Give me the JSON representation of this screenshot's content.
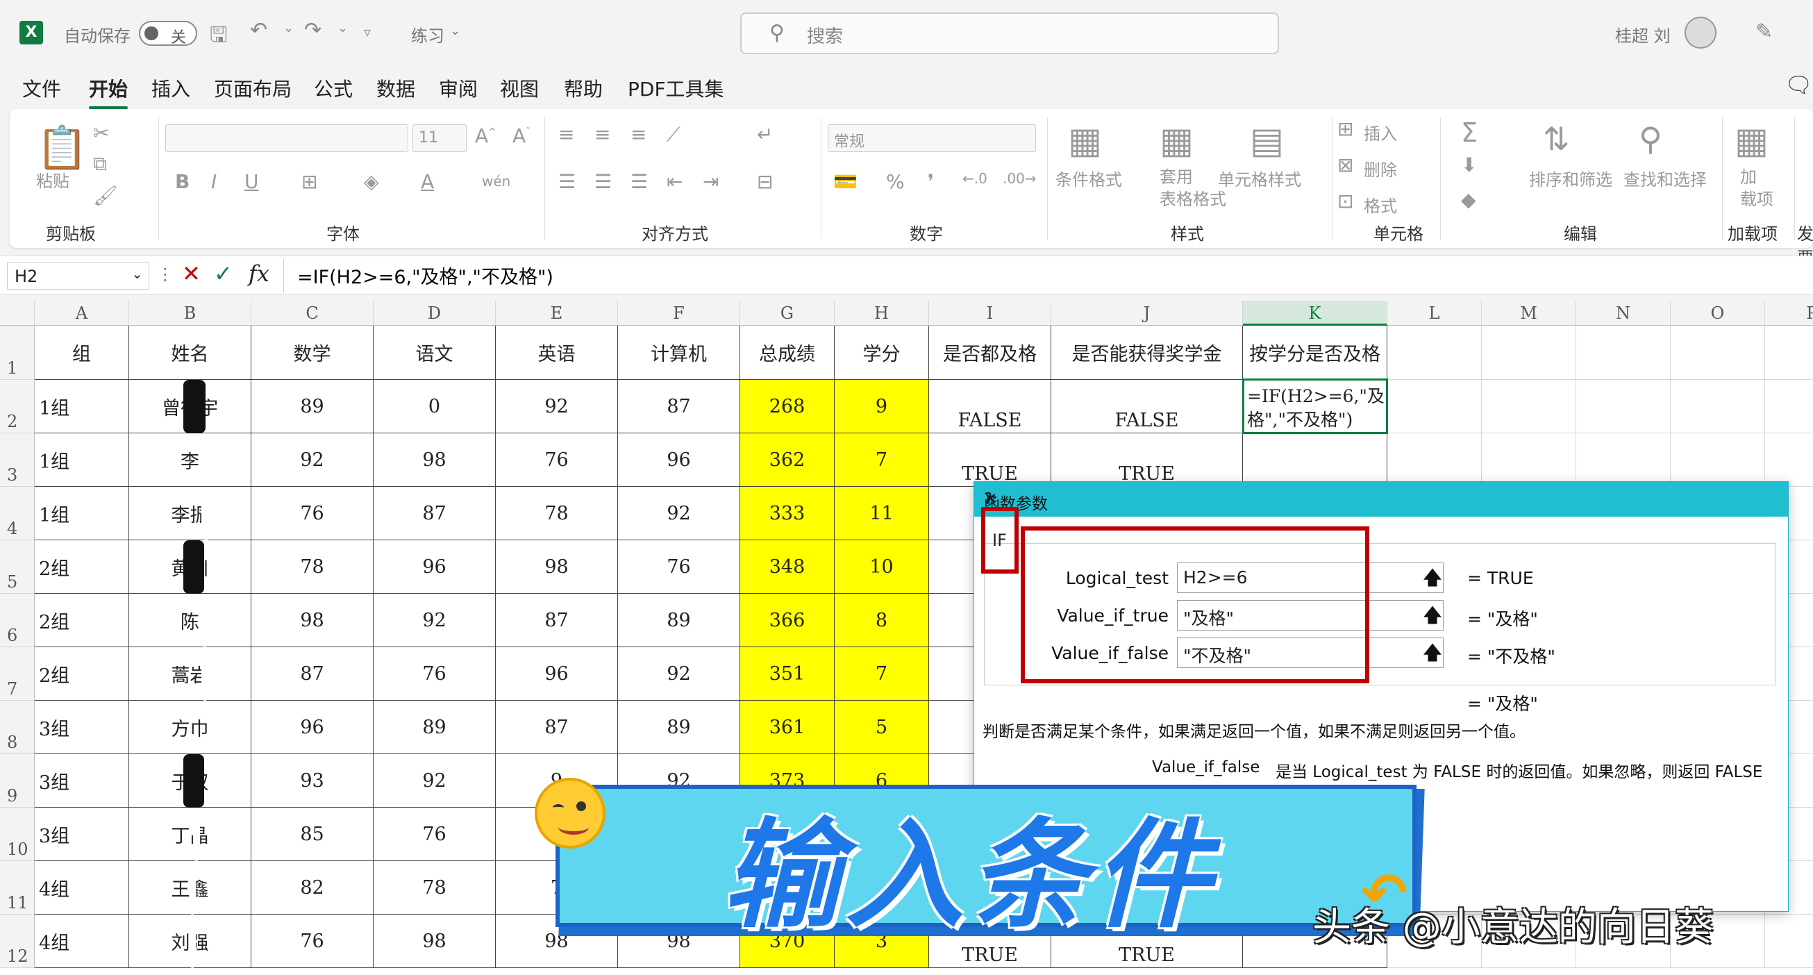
{
  "titlebar": {
    "autosave_label": "自动保存",
    "autosave_state": "关",
    "filename": "练习",
    "search_placeholder": "搜索",
    "user_name": "桂超 刘"
  },
  "menu": [
    "文件",
    "开始",
    "插入",
    "页面布局",
    "公式",
    "数据",
    "审阅",
    "视图",
    "帮助",
    "PDF工具集"
  ],
  "ribbon": {
    "groups": [
      "剪贴板",
      "字体",
      "对齐方式",
      "数字",
      "样式",
      "单元格",
      "编辑",
      "加载项",
      "发票"
    ],
    "paste": "粘贴",
    "font_size": "11",
    "number_format": "常规",
    "cond_format": "条件格式",
    "table_format": "套用\n表格格式",
    "cell_style": "单元格样式",
    "insert": "插入",
    "delete": "删除",
    "format": "格式",
    "sort_filter": "排序和筛选",
    "find_select": "查找和选择",
    "addins": "加\n载项"
  },
  "formula_bar": {
    "name_box": "H2",
    "formula": "=IF(H2>=6,\"及格\",\"不及格\")"
  },
  "columns": [
    "A",
    "B",
    "C",
    "D",
    "E",
    "F",
    "G",
    "H",
    "I",
    "J",
    "K",
    "L",
    "M",
    "N",
    "O",
    "P"
  ],
  "rows": [
    "1",
    "2",
    "3",
    "4",
    "5",
    "6",
    "7",
    "8",
    "9",
    "10",
    "11",
    "12"
  ],
  "header_row": [
    "组",
    "姓名",
    "数学",
    "语文",
    "英语",
    "计算机",
    "总成绩",
    "学分",
    "是否都及格",
    "是否能获得奖学金",
    "按学分是否及格"
  ],
  "data_rows": [
    [
      "1组",
      "曾德宇",
      "89",
      "0",
      "92",
      "87",
      "268",
      "9",
      "FALSE",
      "FALSE"
    ],
    [
      "1组",
      "李",
      "92",
      "98",
      "76",
      "96",
      "362",
      "7",
      "TRUE",
      "TRUE"
    ],
    [
      "1组",
      "李振",
      "76",
      "87",
      "78",
      "92",
      "333",
      "11",
      "",
      ""
    ],
    [
      "2组",
      "黄川",
      "78",
      "96",
      "98",
      "76",
      "348",
      "10",
      "",
      ""
    ],
    [
      "2组",
      "陈",
      "98",
      "92",
      "87",
      "89",
      "366",
      "8",
      "",
      ""
    ],
    [
      "2组",
      "蒿岩",
      "87",
      "76",
      "96",
      "92",
      "351",
      "7",
      "",
      ""
    ],
    [
      "3组",
      "方巾",
      "96",
      "89",
      "87",
      "89",
      "361",
      "5",
      "",
      ""
    ],
    [
      "3组",
      "于双",
      "93",
      "92",
      "9",
      "92",
      "373",
      "6",
      "",
      ""
    ],
    [
      "3组",
      "丁晶",
      "85",
      "76",
      "",
      "",
      "",
      "",
      "",
      ""
    ],
    [
      "4组",
      "王鑫",
      "82",
      "78",
      "7",
      "",
      "",
      "",
      "",
      ""
    ],
    [
      "4组",
      "刘强",
      "76",
      "98",
      "98",
      "98",
      "370",
      "3",
      "TRUE",
      "TRUE"
    ]
  ],
  "active_cell_text": "=IF(H2>=6,\"及\n格\",\"不及格\")",
  "dialog": {
    "title": "函数参数",
    "help": "?",
    "close": "✕",
    "function_name": "IF",
    "args": [
      {
        "label": "Logical_test",
        "value": "H2>=6",
        "result": "TRUE"
      },
      {
        "label": "Value_if_true",
        "value": "\"及格\"",
        "result": "\"及格\""
      },
      {
        "label": "Value_if_false",
        "value": "\"不及格\"",
        "result": "\"不及格\""
      }
    ],
    "formula_result": "\"及格\"",
    "description": "判断是否满足某个条件，如果满足返回一个值，如果不满足则返回另一个值。",
    "arg_help_name": "Value_if_false",
    "arg_help_text": "是当 Logical_test 为 FALSE 时的返回值。如果忽略，则返回 FALSE"
  },
  "overlay": {
    "banner_text": "输入条件",
    "watermark": "头条 @小意达的向日葵"
  },
  "colors": {
    "excel_green": "#107c41",
    "highlight_yellow": "#ffff00",
    "dialog_title": "#20bed0",
    "red_box": "#c00000",
    "banner_fill": "#5fd6f0"
  }
}
